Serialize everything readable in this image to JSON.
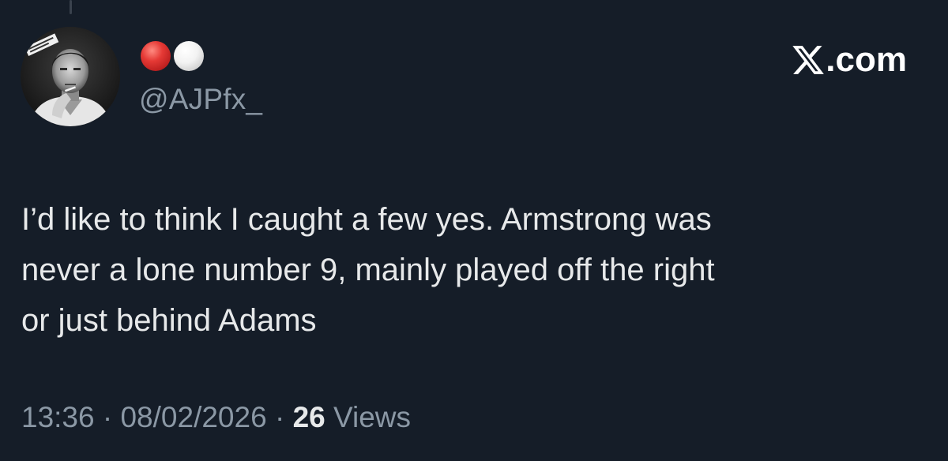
{
  "tweet": {
    "author_emoji": [
      "red-circle",
      "white-circle"
    ],
    "handle": "@AJPfx_",
    "text": "I’d like to think I caught a few yes. Armstrong was\nnever a lone number 9, mainly played off the right\nor just behind Adams",
    "time": "13:36",
    "date": "08/02/2026",
    "separator": "·",
    "views_count": "26",
    "views_label": "Views"
  },
  "brand": {
    "label": ".com",
    "icon": "x-logo-icon"
  },
  "avatar": {
    "icon": "profile-avatar"
  },
  "colors": {
    "background": "#151d28",
    "text_primary": "#e7e9ea",
    "text_secondary": "#8b98a5",
    "emoji_red": "#e53935",
    "emoji_white": "#f2f2f2"
  }
}
